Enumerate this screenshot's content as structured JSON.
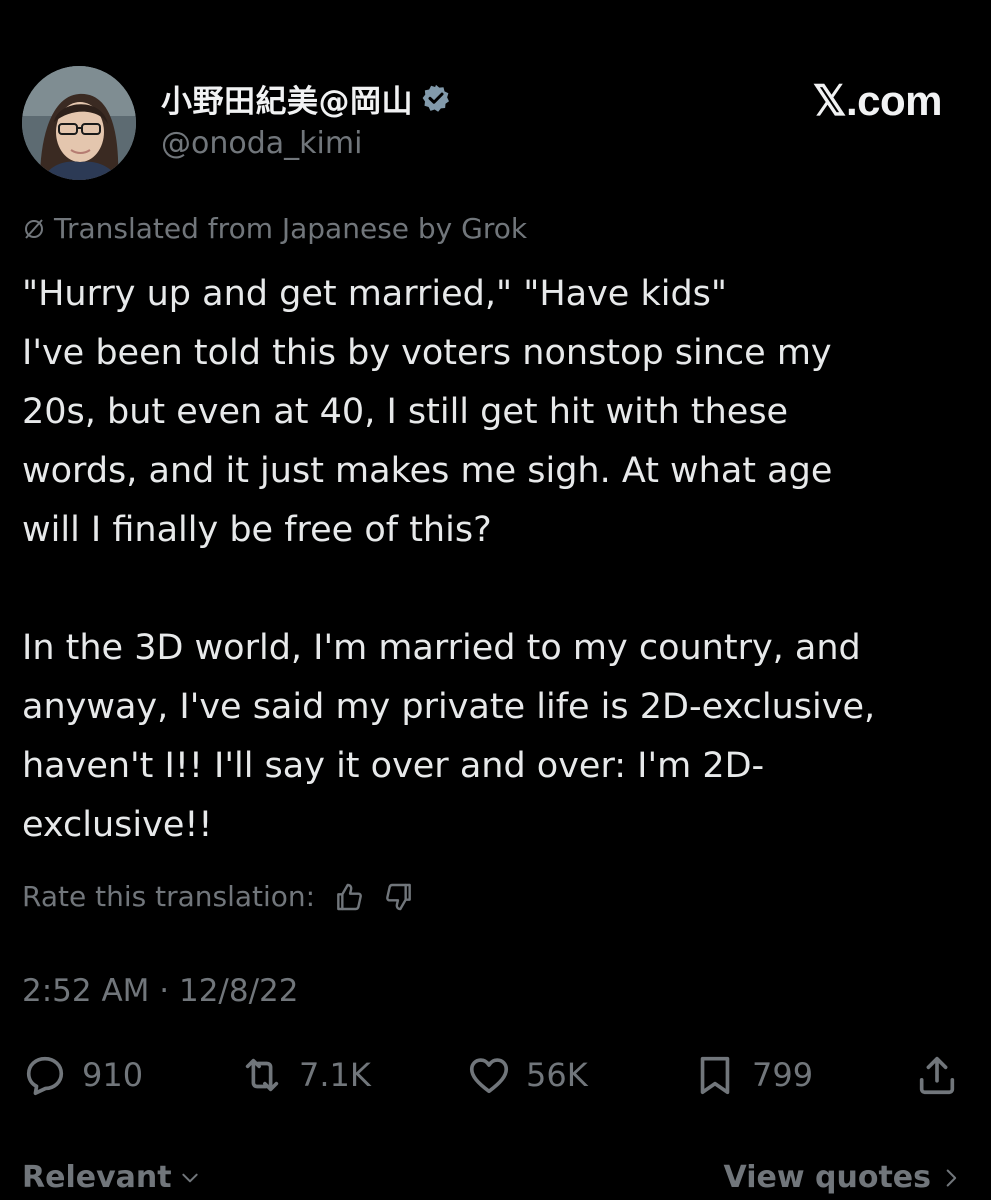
{
  "author": {
    "display_name": "小野田紀美@岡山",
    "handle": "@onoda_kimi",
    "verified_icon": "verified-badge-icon",
    "avatar_icon": "avatar"
  },
  "brand": {
    "label": "𝕏.com"
  },
  "translation": {
    "notice": "Translated from Japanese by Grok",
    "rate_label": "Rate this translation:"
  },
  "tweet": {
    "paragraph1_line1": "\"Hurry up and get married,\" \"Have kids\"",
    "paragraph1_line2": "I've been told this by voters nonstop since my",
    "paragraph1_line3": "20s, but even at 40, I still get hit with these",
    "paragraph1_line4": "words, and it just makes me sigh. At what age",
    "paragraph1_line5": "will I finally be free of this?",
    "paragraph2_line1": "In the 3D world, I'm married to my country, and",
    "paragraph2_line2": "anyway, I've said my private life is 2D-exclusive,",
    "paragraph2_line3": "haven't I!! I'll say it over and over: I'm 2D-",
    "paragraph2_line4": "exclusive!!"
  },
  "timestamp": "2:52 AM · 12/8/22",
  "actions": {
    "replies": "910",
    "reposts": "7.1K",
    "likes": "56K",
    "bookmarks": "799"
  },
  "footer": {
    "sort_label": "Relevant",
    "view_quotes_label": "View quotes"
  }
}
